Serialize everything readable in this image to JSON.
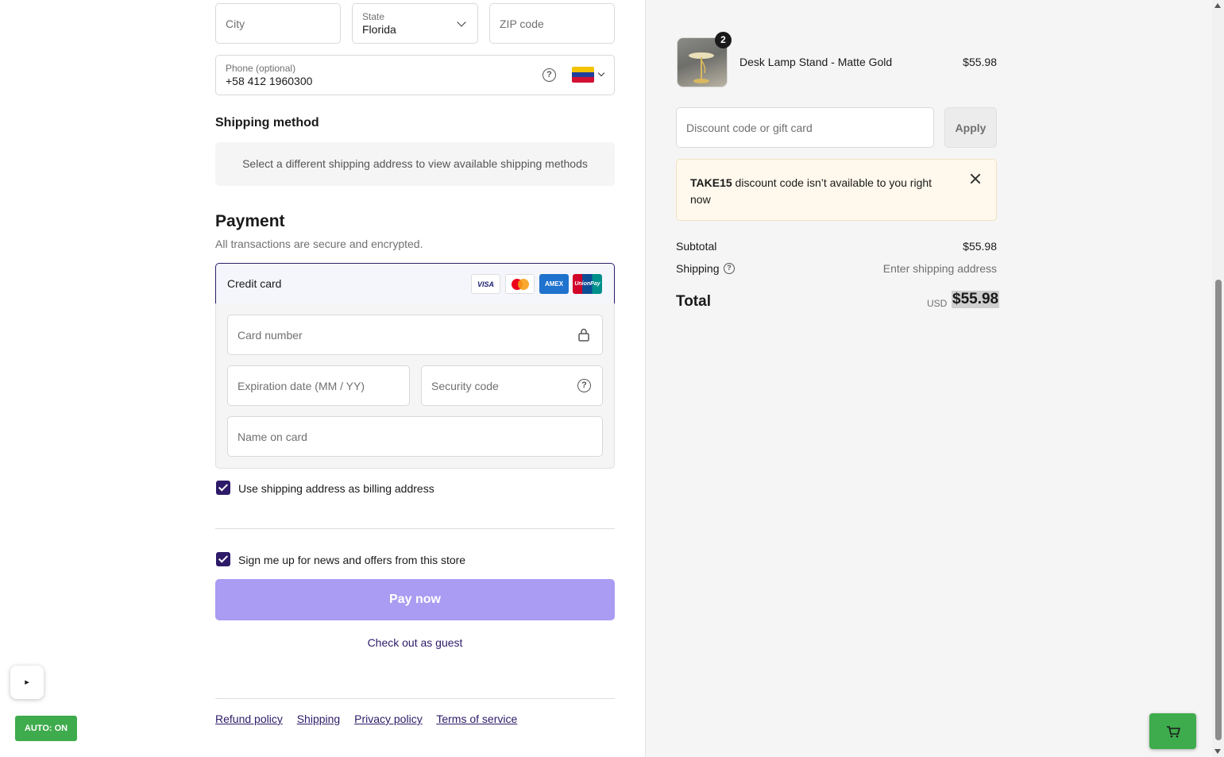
{
  "address": {
    "city_placeholder": "City",
    "state_label": "State",
    "state_value": "Florida",
    "zip_placeholder": "ZIP code",
    "phone_label": "Phone (optional)",
    "phone_value": "+58 412 1960300",
    "phone_help_glyph": "?",
    "country_flag": "venezuela-flag"
  },
  "shipping": {
    "heading": "Shipping method",
    "message": "Select a different shipping address to view available shipping methods"
  },
  "payment": {
    "heading": "Payment",
    "subtitle": "All transactions are secure and encrypted.",
    "method_label": "Credit card",
    "card_logos": [
      "VISA",
      "Mastercard",
      "AMEX",
      "UnionPay"
    ],
    "card_number_placeholder": "Card number",
    "expiration_placeholder": "Expiration date (MM / YY)",
    "security_placeholder": "Security code",
    "name_placeholder": "Name on card",
    "billing_checkbox_label": "Use shipping address as billing address",
    "billing_checked": true
  },
  "newsletter": {
    "label": "Sign me up for news and offers from this store",
    "checked": true
  },
  "actions": {
    "pay_now": "Pay now",
    "guest": "Check out as guest"
  },
  "footer": {
    "links": [
      "Refund policy",
      "Shipping",
      "Privacy policy",
      "Terms of service"
    ]
  },
  "overlay": {
    "play_glyph": "▸",
    "auto_badge": "AUTO: ON"
  },
  "summary": {
    "item": {
      "name": "Desk Lamp Stand - Matte Gold",
      "price": "$55.98",
      "quantity": "2"
    },
    "discount_placeholder": "Discount code or gift card",
    "apply_label": "Apply",
    "notice_code": "TAKE15",
    "notice_text": " discount code isn’t available to you right now",
    "subtotal_label": "Subtotal",
    "subtotal_value": "$55.98",
    "shipping_label": "Shipping",
    "shipping_value": "Enter shipping address",
    "total_label": "Total",
    "currency": "USD",
    "total_value": "$55.98"
  },
  "colors": {
    "accent": "#2d1b69",
    "pay_button": "#a99cf2",
    "notice_bg": "#fff8ec",
    "auto_badge": "#3eab4c"
  }
}
